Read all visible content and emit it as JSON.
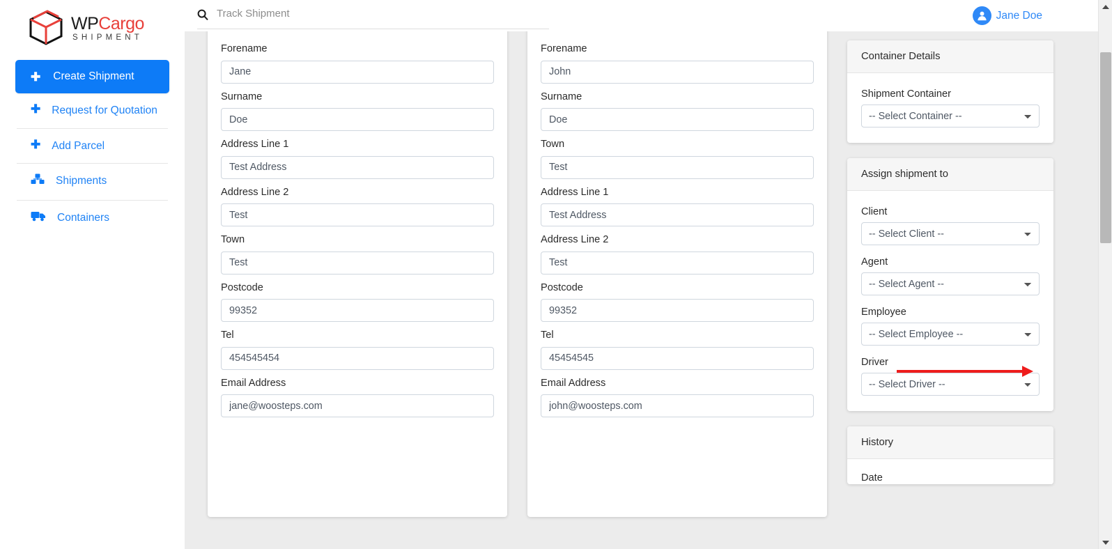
{
  "brand": {
    "name_part1": "WP",
    "name_part2": "Cargo",
    "subtitle": "SHIPMENT",
    "accent_red": "#e8403a",
    "accent_blue": "#0d7bf7"
  },
  "sidebar": {
    "primary": {
      "label": "Create Shipment",
      "icon": "plus-icon"
    },
    "items": [
      {
        "label": "Request for Quotation",
        "icon": "plus-icon"
      },
      {
        "label": "Add Parcel",
        "icon": "plus-icon"
      },
      {
        "label": "Shipments",
        "icon": "boxes-icon"
      },
      {
        "label": "Containers",
        "icon": "truck-icon"
      }
    ]
  },
  "topbar": {
    "search": {
      "placeholder": "Track Shipment",
      "value": "",
      "icon": "search-icon"
    },
    "user": {
      "name": "Jane Doe",
      "icon": "user-avatar-icon"
    }
  },
  "sender_form": {
    "fields": [
      {
        "label": "Forename",
        "value": "Jane"
      },
      {
        "label": "Surname",
        "value": "Doe"
      },
      {
        "label": "Address Line 1",
        "value": "Test Address"
      },
      {
        "label": "Address Line 2",
        "value": "Test"
      },
      {
        "label": "Town",
        "value": "Test"
      },
      {
        "label": "Postcode",
        "value": "99352"
      },
      {
        "label": "Tel",
        "value": "454545454"
      },
      {
        "label": "Email Address",
        "value": "jane@woosteps.com"
      }
    ]
  },
  "receiver_form": {
    "fields": [
      {
        "label": "Forename",
        "value": "John"
      },
      {
        "label": "Surname",
        "value": "Doe"
      },
      {
        "label": "Town",
        "value": "Test"
      },
      {
        "label": "Address Line 1",
        "value": "Test Address"
      },
      {
        "label": "Address Line 2",
        "value": "Test"
      },
      {
        "label": "Postcode",
        "value": "99352"
      },
      {
        "label": "Tel",
        "value": "45454545"
      },
      {
        "label": "Email Address",
        "value": "john@woosteps.com"
      }
    ]
  },
  "container_panel": {
    "title": "Container Details",
    "select_label": "Shipment Container",
    "select_value": "-- Select Container --"
  },
  "assign_panel": {
    "title": "Assign shipment to",
    "selects": [
      {
        "label": "Client",
        "value": "-- Select Client --"
      },
      {
        "label": "Agent",
        "value": "-- Select Agent --"
      },
      {
        "label": "Employee",
        "value": "-- Select Employee --"
      },
      {
        "label": "Driver",
        "value": "-- Select Driver --"
      }
    ]
  },
  "history_panel": {
    "title": "History",
    "column_date": "Date"
  },
  "annotation": {
    "arrow_color": "#ee1c1c",
    "points_to": "-- Select Employee --"
  }
}
